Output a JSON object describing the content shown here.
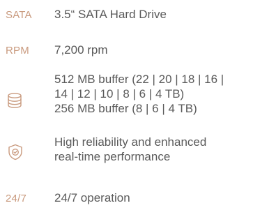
{
  "specs": [
    {
      "tag": "SATA",
      "lines": [
        "3.5“ SATA Hard Drive"
      ]
    },
    {
      "tag": "RPM",
      "lines": [
        "7,200 rpm"
      ]
    },
    {
      "icon": "database-icon",
      "lines": [
        "512 MB buffer (22 | 20 | 18 | 16 |",
        "14 | 12 | 10 | 8 | 6 | 4 TB)",
        "256 MB buffer (8 | 6 | 4 TB)"
      ]
    },
    {
      "icon": "shield-check-icon",
      "lines": [
        "High reliability and enhanced",
        "real-time performance"
      ]
    },
    {
      "tag": "24/7",
      "lines": [
        "24/7 operation"
      ]
    }
  ],
  "colors": {
    "accent": "#c99a7e",
    "text": "#5a5a5a"
  }
}
